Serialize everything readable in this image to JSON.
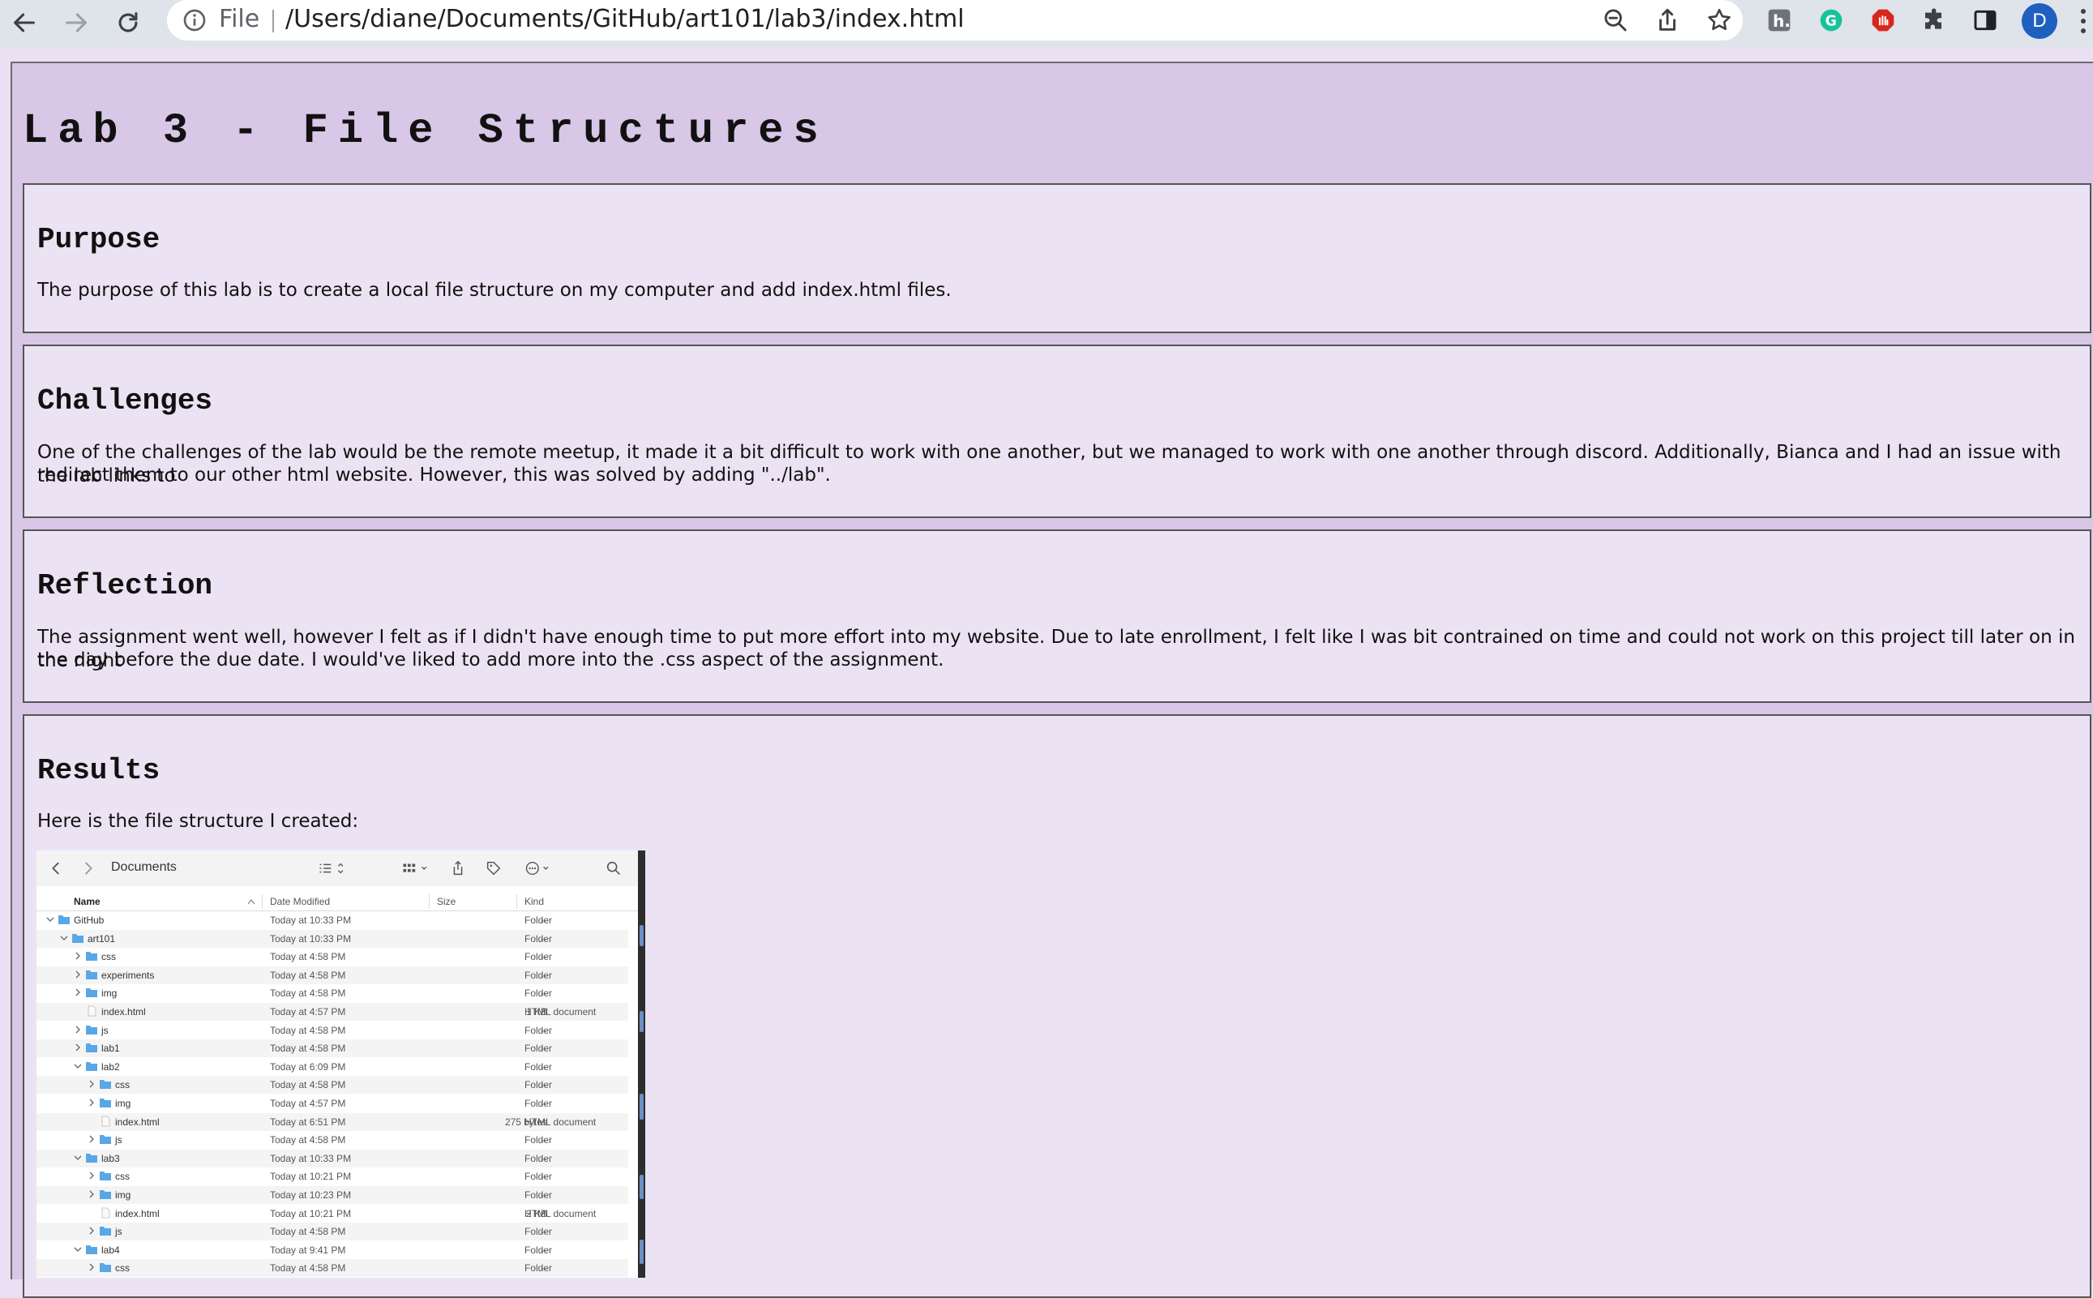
{
  "browser": {
    "scheme_label": "File",
    "url": "/Users/diane/Documents/GitHub/art101/lab3/index.html",
    "avatar_initial": "D",
    "icons": {
      "back": "arrow-left-icon",
      "forward": "arrow-right-icon",
      "reload": "reload-icon",
      "info": "info-icon",
      "zoom": "zoom-out-icon",
      "share": "share-icon",
      "bookmark": "star-icon",
      "extensions": [
        "honey-extension-icon",
        "grammarly-extension-icon",
        "adblock-extension-icon",
        "puzzle-extensions-icon",
        "side-panel-icon"
      ],
      "menu": "more-vert-icon"
    }
  },
  "page": {
    "title": "Lab 3 - File Structures",
    "sections": [
      {
        "heading": "Purpose",
        "text": "The purpose of this lab is to create a local file structure on my computer and add index.html files."
      },
      {
        "heading": "Challenges",
        "text_line1": "One of the challenges of the lab would be the remote meetup, it made it a bit difficult to work with one another, but we managed to work with one another through discord. Additionally, Bianca and I had an issue with the lab links to",
        "text_line2": "redirect them to our other html website. However, this was solved by adding \"../lab\"."
      },
      {
        "heading": "Reflection",
        "text_line1": "The assignment went well, however I felt as if I didn't have enough time to put more effort into my website. Due to late enrollment, I felt like I was bit contrained on time and could not work on this project till later on in the night",
        "text_line2": "the day before the due date. I would've liked to add more into the .css aspect of the assignment."
      },
      {
        "heading": "Results",
        "text": "Here is the file structure I created:"
      }
    ]
  },
  "finder": {
    "location": "Documents",
    "columns": {
      "name": "Name",
      "date": "Date Modified",
      "size": "Size",
      "kind": "Kind"
    },
    "rows": [
      {
        "name": "GitHub",
        "indent": 0,
        "type": "folder",
        "expanded": true,
        "date": "Today at 10:33 PM",
        "size": "--",
        "kind": "Folder"
      },
      {
        "name": "art101",
        "indent": 1,
        "type": "folder",
        "expanded": true,
        "date": "Today at 10:33 PM",
        "size": "--",
        "kind": "Folder"
      },
      {
        "name": "css",
        "indent": 2,
        "type": "folder",
        "expanded": false,
        "date": "Today at 4:58 PM",
        "size": "--",
        "kind": "Folder"
      },
      {
        "name": "experiments",
        "indent": 2,
        "type": "folder",
        "expanded": false,
        "date": "Today at 4:58 PM",
        "size": "--",
        "kind": "Folder"
      },
      {
        "name": "img",
        "indent": 2,
        "type": "folder",
        "expanded": false,
        "date": "Today at 4:58 PM",
        "size": "--",
        "kind": "Folder"
      },
      {
        "name": "index.html",
        "indent": 2,
        "type": "file",
        "date": "Today at 4:57 PM",
        "size": "1 KB",
        "kind": "HTML document"
      },
      {
        "name": "js",
        "indent": 2,
        "type": "folder",
        "expanded": false,
        "date": "Today at 4:58 PM",
        "size": "--",
        "kind": "Folder"
      },
      {
        "name": "lab1",
        "indent": 2,
        "type": "folder",
        "expanded": false,
        "date": "Today at 4:58 PM",
        "size": "--",
        "kind": "Folder"
      },
      {
        "name": "lab2",
        "indent": 2,
        "type": "folder",
        "expanded": true,
        "date": "Today at 6:09 PM",
        "size": "--",
        "kind": "Folder"
      },
      {
        "name": "css",
        "indent": 3,
        "type": "folder",
        "expanded": false,
        "date": "Today at 4:58 PM",
        "size": "--",
        "kind": "Folder"
      },
      {
        "name": "img",
        "indent": 3,
        "type": "folder",
        "expanded": false,
        "date": "Today at 4:57 PM",
        "size": "--",
        "kind": "Folder"
      },
      {
        "name": "index.html",
        "indent": 3,
        "type": "file",
        "date": "Today at 6:51 PM",
        "size": "275 bytes",
        "kind": "HTML document"
      },
      {
        "name": "js",
        "indent": 3,
        "type": "folder",
        "expanded": false,
        "date": "Today at 4:58 PM",
        "size": "--",
        "kind": "Folder"
      },
      {
        "name": "lab3",
        "indent": 2,
        "type": "folder",
        "expanded": true,
        "date": "Today at 10:33 PM",
        "size": "--",
        "kind": "Folder"
      },
      {
        "name": "css",
        "indent": 3,
        "type": "folder",
        "expanded": false,
        "date": "Today at 10:21 PM",
        "size": "--",
        "kind": "Folder"
      },
      {
        "name": "img",
        "indent": 3,
        "type": "folder",
        "expanded": false,
        "date": "Today at 10:23 PM",
        "size": "--",
        "kind": "Folder"
      },
      {
        "name": "index.html",
        "indent": 3,
        "type": "file",
        "date": "Today at 10:21 PM",
        "size": "2 KB",
        "kind": "HTML document"
      },
      {
        "name": "js",
        "indent": 3,
        "type": "folder",
        "expanded": false,
        "date": "Today at 4:58 PM",
        "size": "--",
        "kind": "Folder"
      },
      {
        "name": "lab4",
        "indent": 2,
        "type": "folder",
        "expanded": true,
        "date": "Today at 9:41 PM",
        "size": "--",
        "kind": "Folder"
      },
      {
        "name": "css",
        "indent": 3,
        "type": "folder",
        "expanded": false,
        "date": "Today at 4:58 PM",
        "size": "--",
        "kind": "Folder"
      }
    ]
  },
  "colors": {
    "page_background": "#d8c7e7",
    "section_background": "#ebe3f3",
    "finder_folder": "#5aa7e6"
  }
}
